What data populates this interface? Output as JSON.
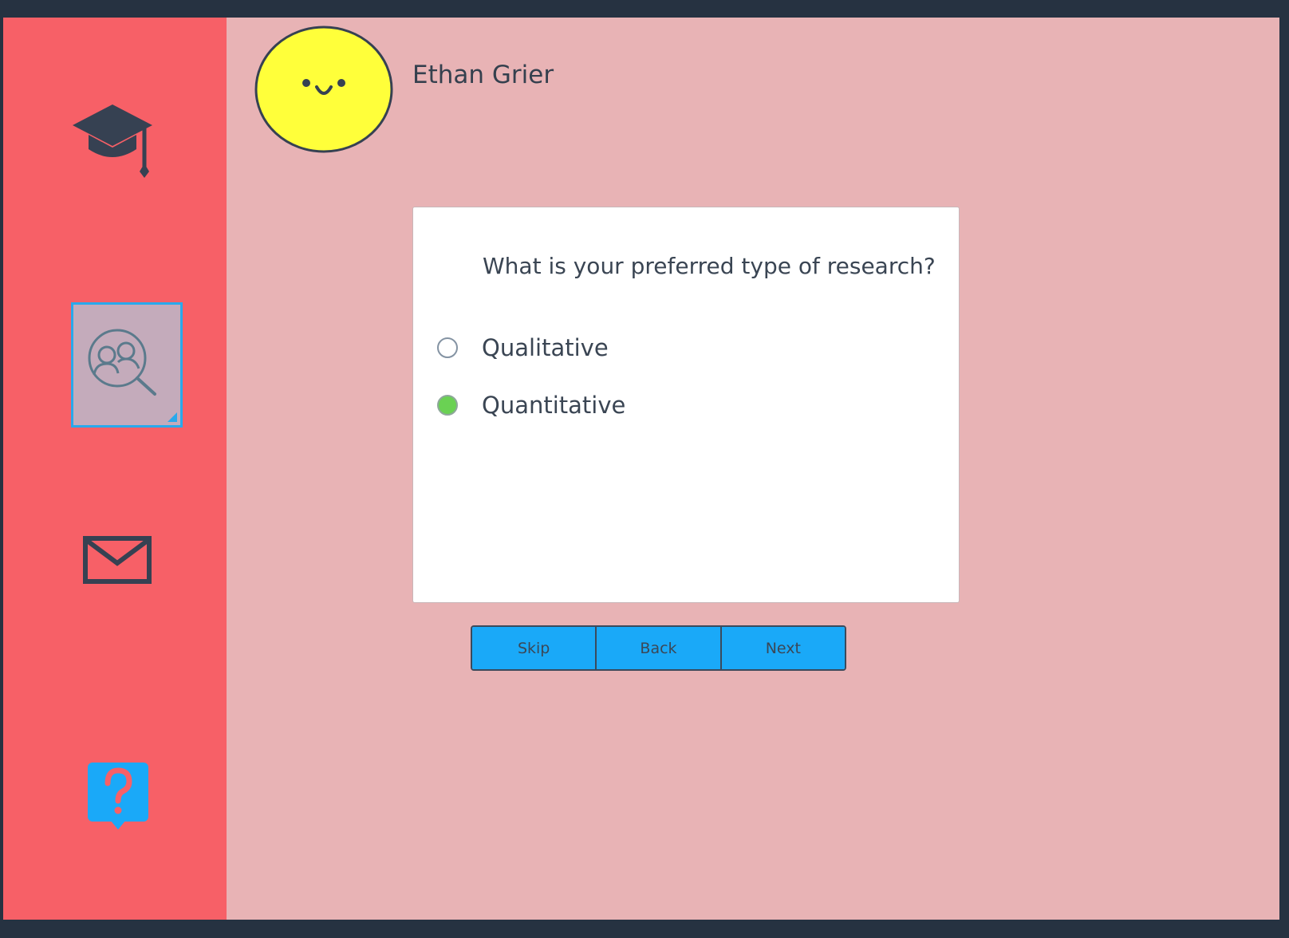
{
  "user": {
    "name": "Ethan Grier",
    "avatar_icon": "smiley-face-icon"
  },
  "sidebar": {
    "items": [
      {
        "icon": "graduation-cap-icon",
        "active": false
      },
      {
        "icon": "people-search-icon",
        "active": true
      },
      {
        "icon": "mail-icon",
        "active": false
      },
      {
        "icon": "help-question-icon",
        "active": false
      }
    ]
  },
  "survey": {
    "question": "What is your preferred type of research?",
    "options": [
      {
        "label": "Qualitative",
        "selected": false
      },
      {
        "label": "Quantitative",
        "selected": true
      }
    ]
  },
  "buttons": {
    "skip": "Skip",
    "back": "Back",
    "next": "Next"
  },
  "colors": {
    "sidebar": "#f76067",
    "content_bg": "#e8b3b5",
    "accent": "#1aa9f8",
    "selected_radio": "#6ad153",
    "avatar": "#ffff3a",
    "icon_dark": "#364152"
  }
}
